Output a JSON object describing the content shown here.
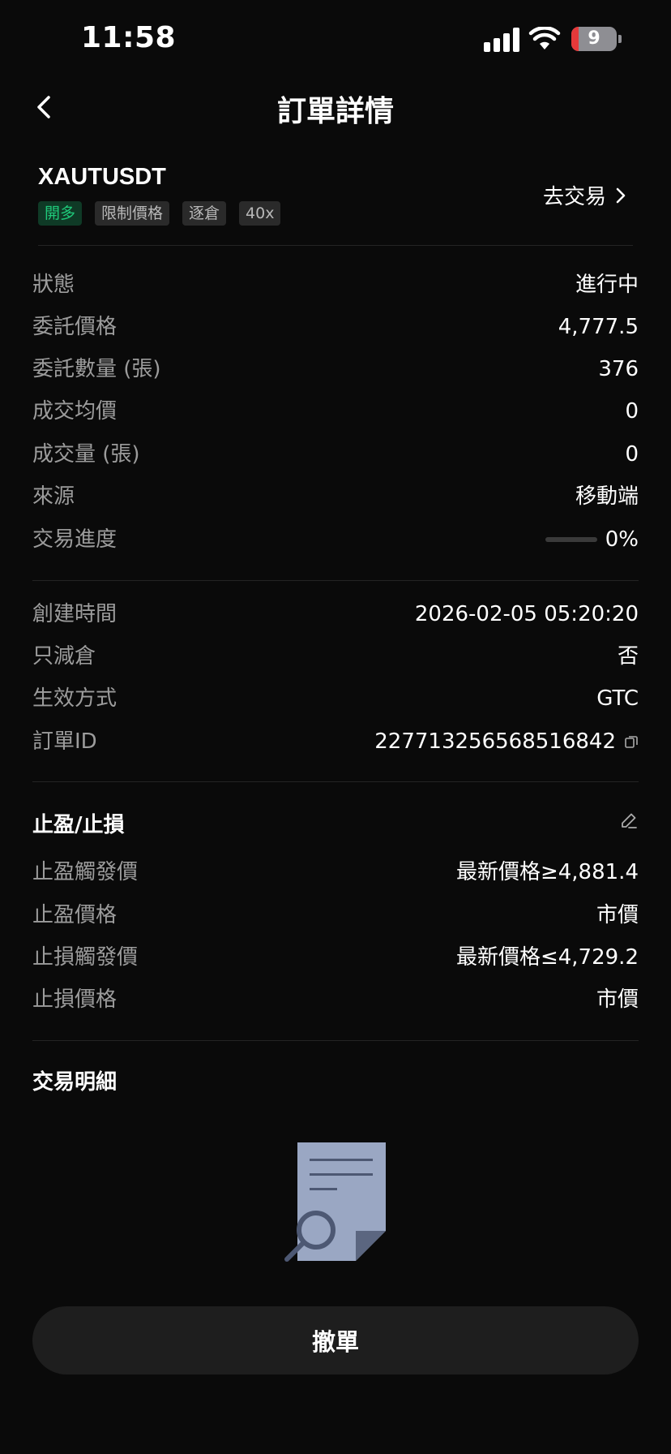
{
  "status_bar": {
    "time": "11:58",
    "battery_level": "9"
  },
  "nav": {
    "title": "訂單詳情"
  },
  "order": {
    "symbol": "XAUTUSDT",
    "tags": [
      "開多",
      "限制價格",
      "逐倉",
      "40x"
    ],
    "goto_label": "去交易"
  },
  "details": [
    {
      "label": "狀態",
      "value": "進行中"
    },
    {
      "label": "委託價格",
      "value": "4,777.5"
    },
    {
      "label": "委託數量 (張)",
      "value": "376"
    },
    {
      "label": "成交均價",
      "value": "0"
    },
    {
      "label": "成交量 (張)",
      "value": "0"
    },
    {
      "label": "來源",
      "value": "移動端"
    },
    {
      "label": "交易進度",
      "value": "0%",
      "progress": 0
    }
  ],
  "meta": [
    {
      "label": "創建時間",
      "value": "2026-02-05 05:20:20"
    },
    {
      "label": "只減倉",
      "value": "否"
    },
    {
      "label": "生效方式",
      "value": "GTC"
    },
    {
      "label": "訂單ID",
      "value": "227713256568516842"
    }
  ],
  "tp_sl": {
    "title": "止盈/止損",
    "rows": [
      {
        "label": "止盈觸發價",
        "value": "最新價格≥4,881.4"
      },
      {
        "label": "止盈價格",
        "value": "市價"
      },
      {
        "label": "止損觸發價",
        "value": "最新價格≤4,729.2"
      },
      {
        "label": "止損價格",
        "value": "市價"
      }
    ]
  },
  "trade_details": {
    "title": "交易明細"
  },
  "actions": {
    "cancel_label": "撤單"
  },
  "colors": {
    "background": "#0a0a0a",
    "long_green": "#1fc97a",
    "battery_red": "#e5393a"
  }
}
